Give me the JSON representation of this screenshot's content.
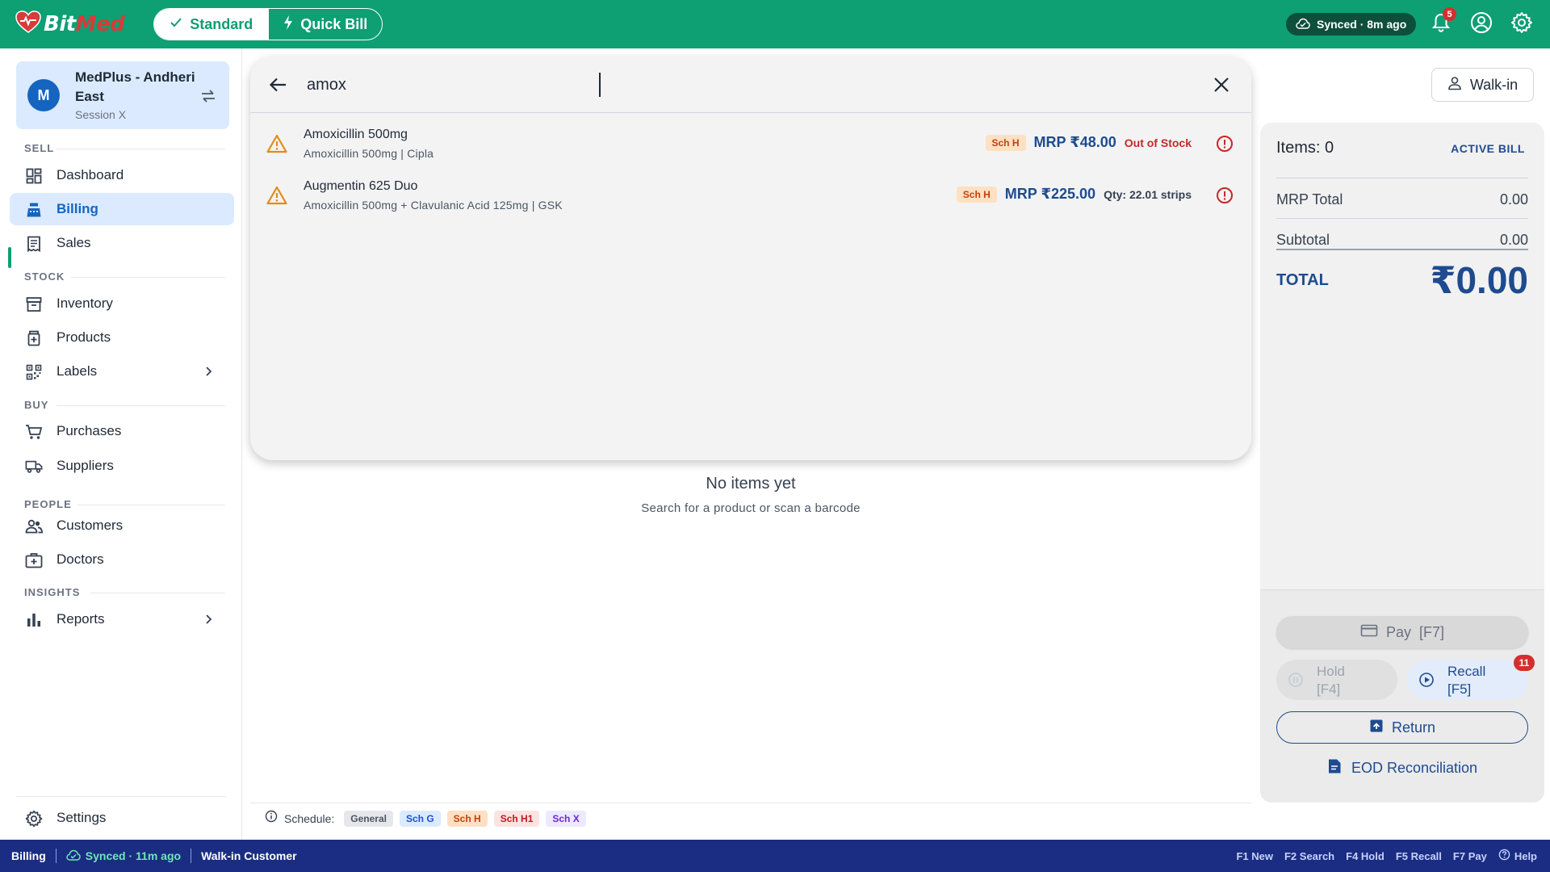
{
  "app": {
    "logo_part1": "Bit",
    "logo_part2": "Med",
    "brand_color": "#0e9f73"
  },
  "header": {
    "mode_standard": "Standard",
    "mode_quick": "Quick Bill",
    "sync_status": "Synced · 8m ago",
    "notification_count": "5"
  },
  "store": {
    "avatar_letter": "M",
    "name": "MedPlus - Andheri East",
    "session": "Session X"
  },
  "sidebar": {
    "sections": {
      "sell": "SELL",
      "stock": "STOCK",
      "buy": "BUY",
      "people": "PEOPLE",
      "insights": "INSIGHTS"
    },
    "items": {
      "dashboard": "Dashboard",
      "billing": "Billing",
      "sales": "Sales",
      "inventory": "Inventory",
      "products": "Products",
      "labels": "Labels",
      "purchases": "Purchases",
      "suppliers": "Suppliers",
      "customers": "Customers",
      "doctors": "Doctors",
      "reports": "Reports",
      "settings": "Settings"
    },
    "active_item": "Billing"
  },
  "search": {
    "query": "amox",
    "results": [
      {
        "name": "Amoxicillin 500mg",
        "subtitle": "Amoxicillin 500mg | Cipla",
        "schedule": "Sch H",
        "mrp": "MRP ₹48.00",
        "stock": "Out of Stock"
      },
      {
        "name": "Augmentin 625 Duo",
        "subtitle": "Amoxicillin 500mg + Clavulanic Acid 125mg | GSK",
        "schedule": "Sch H",
        "mrp": "MRP ₹225.00",
        "stock": "Qty: 22.01 strips"
      }
    ]
  },
  "empty_state": {
    "title": "No items yet",
    "subtitle": "Search for a product or scan a barcode"
  },
  "schedule_legend": {
    "label": "Schedule:",
    "chips": [
      {
        "label": "General",
        "bg": "#e5e7eb",
        "fg": "#4b5563"
      },
      {
        "label": "Sch G",
        "bg": "#dbeafe",
        "fg": "#1d4ed8"
      },
      {
        "label": "Sch H",
        "bg": "#ffe0c2",
        "fg": "#c2410c"
      },
      {
        "label": "Sch H1",
        "bg": "#fde2e2",
        "fg": "#b91c1c"
      },
      {
        "label": "Sch X",
        "bg": "#ede9fe",
        "fg": "#6d28d9"
      }
    ]
  },
  "bill": {
    "walkin_label": "Walk-in",
    "items_label": "Items: 0",
    "status": "ACTIVE BILL",
    "mrp_total_label": "MRP Total",
    "mrp_total_value": "0.00",
    "subtotal_label": "Subtotal",
    "subtotal_value": "0.00",
    "total_label": "TOTAL",
    "total_value": "₹0.00",
    "pay_label": "Pay  [F7]",
    "hold_label": "Hold",
    "hold_key": "[F4]",
    "recall_label": "Recall",
    "recall_key": "[F5]",
    "recall_count": "11",
    "return_label": "Return",
    "eod_label": "EOD Reconciliation"
  },
  "statusbar": {
    "page": "Billing",
    "sync": "Synced · 11m ago",
    "customer": "Walk-in Customer",
    "shortcuts": [
      "F1 New",
      "F2 Search",
      "F4 Hold",
      "F5 Recall",
      "F7 Pay"
    ],
    "help": "Help"
  }
}
